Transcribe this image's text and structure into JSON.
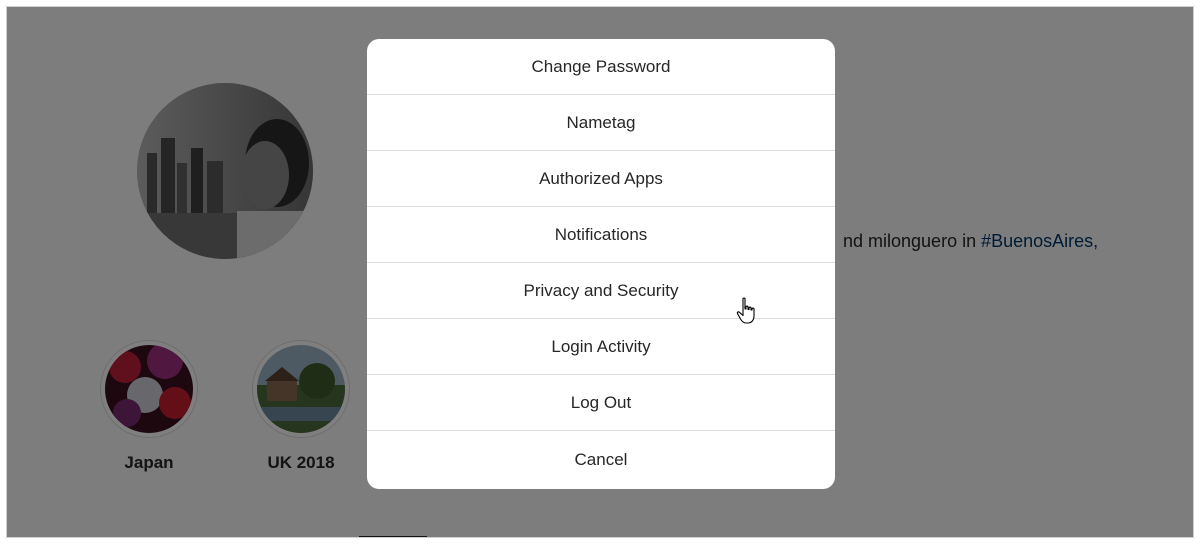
{
  "profile": {
    "bio_visible": "nd milonguero in ",
    "bio_hashtag": "#BuenosAires,"
  },
  "highlights": [
    {
      "label": "Japan"
    },
    {
      "label": "UK 2018"
    }
  ],
  "menu": {
    "items": [
      {
        "label": "Change Password"
      },
      {
        "label": "Nametag"
      },
      {
        "label": "Authorized Apps"
      },
      {
        "label": "Notifications"
      },
      {
        "label": "Privacy and Security"
      },
      {
        "label": "Login Activity"
      },
      {
        "label": "Log Out"
      },
      {
        "label": "Cancel"
      }
    ]
  },
  "colors": {
    "overlay": "#000000",
    "hashtag": "#00376b",
    "text": "#262626"
  },
  "icons": {
    "cursor": "hand-pointer-icon"
  }
}
